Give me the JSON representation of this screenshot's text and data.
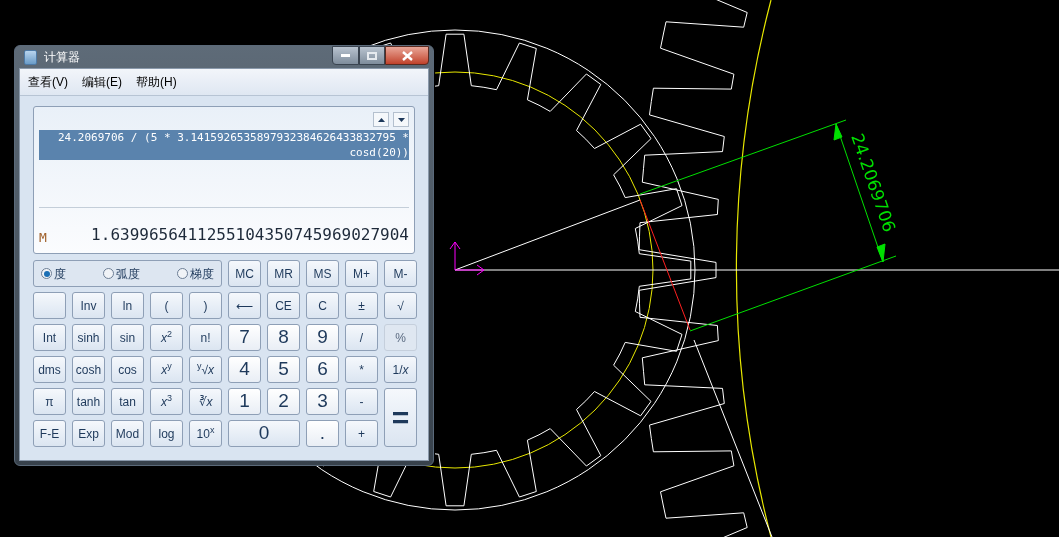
{
  "cad": {
    "dimension": "24.2069706"
  },
  "window": {
    "title": "计算器"
  },
  "menu": [
    "查看(V)",
    "编辑(E)",
    "帮助(H)"
  ],
  "display": {
    "expression": "24.2069706 / (5 * 3.1415926535897932384626433832795 * cosd(20))",
    "expression_selected": true,
    "memory_indicator": "M",
    "result": "1.6399656411255104350745969027904"
  },
  "angle_units": [
    {
      "label": "度",
      "selected": true
    },
    {
      "label": "弧度",
      "selected": false
    },
    {
      "label": "梯度",
      "selected": false
    }
  ],
  "buttons": [
    {
      "label": "MC",
      "kind": "function",
      "disabled": false
    },
    {
      "label": "MR",
      "kind": "function",
      "disabled": false
    },
    {
      "label": "MS",
      "kind": "function",
      "disabled": false
    },
    {
      "label": "M+",
      "kind": "function",
      "disabled": false
    },
    {
      "label": "M-",
      "kind": "function",
      "disabled": false
    },
    {
      "kind": "blank",
      "disabled": false
    },
    {
      "label": "Inv",
      "kind": "function",
      "disabled": false
    },
    {
      "label": "ln",
      "kind": "function",
      "disabled": false
    },
    {
      "label": "(",
      "kind": "function",
      "disabled": false
    },
    {
      "label": ")",
      "kind": "function",
      "disabled": false
    },
    {
      "label": "⟵",
      "kind": "function",
      "disabled": false
    },
    {
      "label": "CE",
      "kind": "function",
      "disabled": false
    },
    {
      "label": "C",
      "kind": "function",
      "disabled": false
    },
    {
      "label": "±",
      "kind": "function",
      "disabled": false
    },
    {
      "label": "√",
      "kind": "function",
      "disabled": false
    },
    {
      "label": "Int",
      "kind": "function",
      "disabled": false
    },
    {
      "label": "sinh",
      "kind": "function",
      "disabled": false
    },
    {
      "label": "sin",
      "kind": "function",
      "disabled": false
    },
    {
      "label": "*x*$^{2}$",
      "kind": "function",
      "disabled": false
    },
    {
      "label": "n!",
      "kind": "function",
      "disabled": false
    },
    {
      "label": "7",
      "kind": "digit",
      "disabled": false
    },
    {
      "label": "8",
      "kind": "digit",
      "disabled": false
    },
    {
      "label": "9",
      "kind": "digit",
      "disabled": false
    },
    {
      "label": "/",
      "kind": "function",
      "disabled": false
    },
    {
      "label": "%",
      "kind": "function",
      "disabled": true
    },
    {
      "label": "dms",
      "kind": "function",
      "disabled": false
    },
    {
      "label": "cosh",
      "kind": "function",
      "disabled": false
    },
    {
      "label": "cos",
      "kind": "function",
      "disabled": false
    },
    {
      "label": "*x*$^{y}$",
      "kind": "function",
      "disabled": false
    },
    {
      "label": "$^{y}$√*x*",
      "kind": "function",
      "disabled": false
    },
    {
      "label": "4",
      "kind": "digit",
      "disabled": false
    },
    {
      "label": "5",
      "kind": "digit",
      "disabled": false
    },
    {
      "label": "6",
      "kind": "digit",
      "disabled": false
    },
    {
      "label": "*",
      "kind": "function",
      "disabled": false
    },
    {
      "label": "1/*x*",
      "kind": "function",
      "disabled": false
    },
    {
      "label": "π",
      "kind": "function",
      "disabled": false
    },
    {
      "label": "tanh",
      "kind": "function",
      "disabled": false
    },
    {
      "label": "tan",
      "kind": "function",
      "disabled": false
    },
    {
      "label": "*x*$^{3}$",
      "kind": "function",
      "disabled": false
    },
    {
      "label": "∛*x*",
      "kind": "function",
      "disabled": false
    },
    {
      "label": "1",
      "kind": "digit",
      "disabled": false
    },
    {
      "label": "2",
      "kind": "digit",
      "disabled": false
    },
    {
      "label": "3",
      "kind": "digit",
      "disabled": false
    },
    {
      "label": "-",
      "kind": "function",
      "disabled": false
    },
    {
      "label": "=",
      "kind": "equals",
      "disabled": false
    },
    {
      "label": "F-E",
      "kind": "function",
      "disabled": false
    },
    {
      "label": "Exp",
      "kind": "function",
      "disabled": false
    },
    {
      "label": "Mod",
      "kind": "function",
      "disabled": false
    },
    {
      "label": "log",
      "kind": "function",
      "disabled": false
    },
    {
      "label": "10$^{x}$",
      "kind": "function",
      "disabled": false
    },
    {
      "label": "0",
      "kind": "zero",
      "disabled": false
    },
    {
      "label": ".",
      "kind": "digit",
      "disabled": false
    },
    {
      "label": "+",
      "kind": "function",
      "disabled": false
    }
  ]
}
